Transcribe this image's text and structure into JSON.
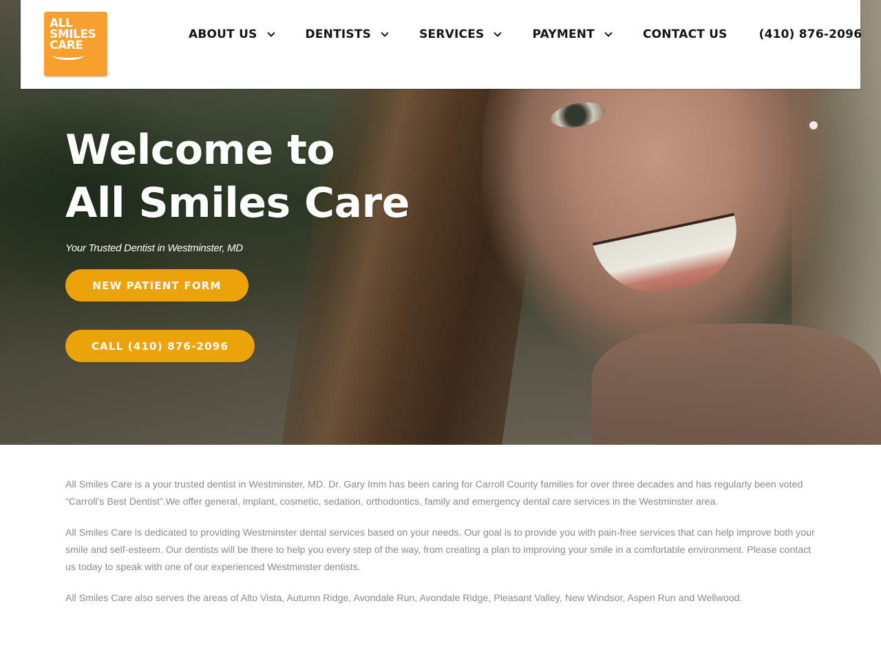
{
  "header": {
    "logo": {
      "lines": [
        "ALL",
        "SMILES",
        "CARE"
      ],
      "color": "#f7a030"
    },
    "nav": [
      {
        "label": "ABOUT US",
        "has_dropdown": true
      },
      {
        "label": "DENTISTS",
        "has_dropdown": true
      },
      {
        "label": "SERVICES",
        "has_dropdown": true
      },
      {
        "label": "PAYMENT",
        "has_dropdown": true
      },
      {
        "label": "CONTACT US",
        "has_dropdown": false
      }
    ],
    "phone": "(410) 876-2096"
  },
  "hero": {
    "title_line1": "Welcome to",
    "title_line2": "All Smiles Care",
    "subtitle": "Your Trusted Dentist in Westminster, MD",
    "buttons": [
      {
        "label": "NEW PATIENT FORM"
      },
      {
        "label": "CALL (410) 876-2096"
      }
    ],
    "accent_color": "#eca30a"
  },
  "content": {
    "paragraphs": [
      "All Smiles Care is a your trusted dentist in Westminster, MD. Dr. Gary Imm has been caring for Carroll County families for over three decades and has regularly been voted “Carroll’s Best Dentist”.We offer general, implant, cosmetic, sedation, orthodontics, family and emergency dental care services in the Westminster area.",
      "All Smiles Care is dedicated to providing Westminster dental services based on your needs. Our goal is to provide you with pain-free services that can help improve both your smile and self-esteem. Our dentists will be there to help you every step of the way, from creating a plan to improving your smile in a comfortable environment. Please contact us today to speak with one of our experienced Westminster dentists.",
      "All Smiles Care also serves the areas of Alto Vista, Autumn Ridge, Avondale Run, Avondale Ridge, Pleasant Valley, New Windsor, Aspen Run and Wellwood."
    ]
  }
}
